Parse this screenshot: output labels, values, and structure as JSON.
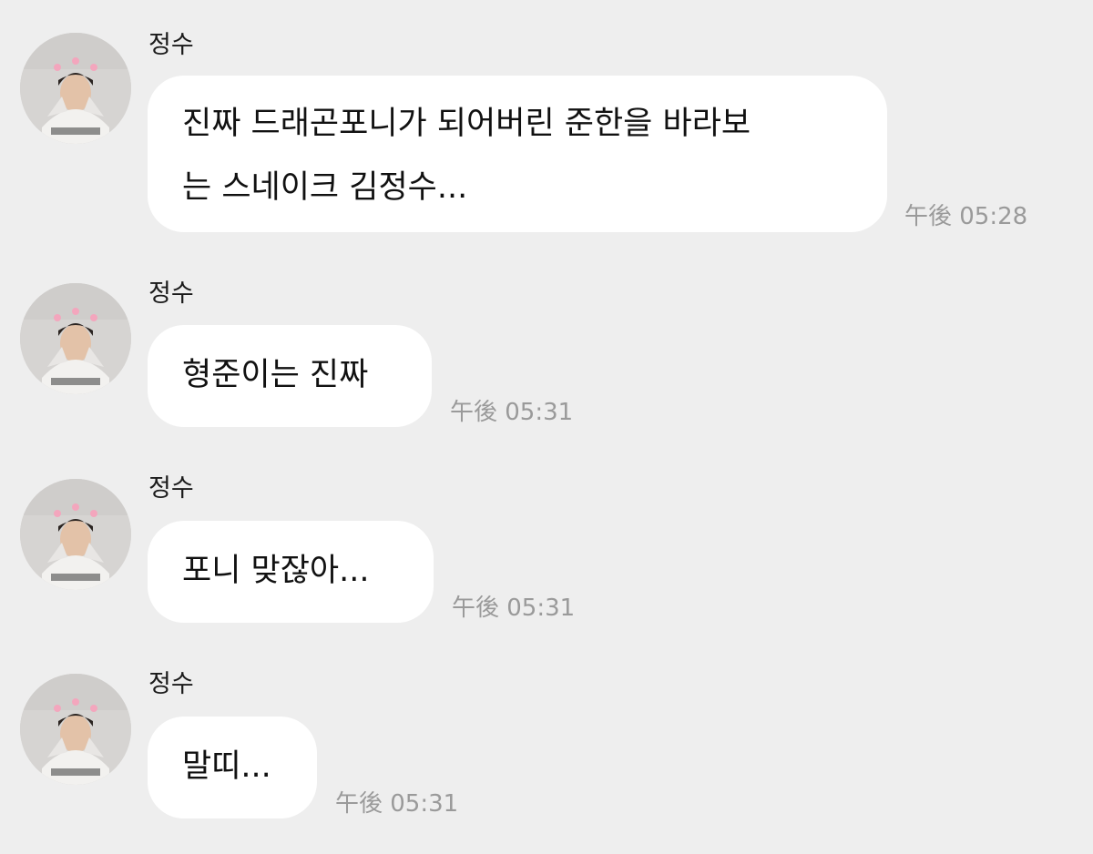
{
  "messages": [
    {
      "sender": "정수",
      "lines": [
        "진짜 드래곤포니가 되어버린 준한을 바라보",
        "는 스네이크 김정수..."
      ],
      "time": "午後 05:28"
    },
    {
      "sender": "정수",
      "lines": [
        "형준이는 진짜"
      ],
      "time": "午後 05:31"
    },
    {
      "sender": "정수",
      "lines": [
        "포니 맞잖아..."
      ],
      "time": "午後 05:31"
    },
    {
      "sender": "정수",
      "lines": [
        "말띠..."
      ],
      "time": "午後 05:31"
    }
  ],
  "colors": {
    "background": "#eeeeee",
    "bubble": "#ffffff",
    "text": "#111111",
    "timestamp": "#9a9a9a"
  },
  "icons": {
    "avatar": "profile-photo"
  }
}
